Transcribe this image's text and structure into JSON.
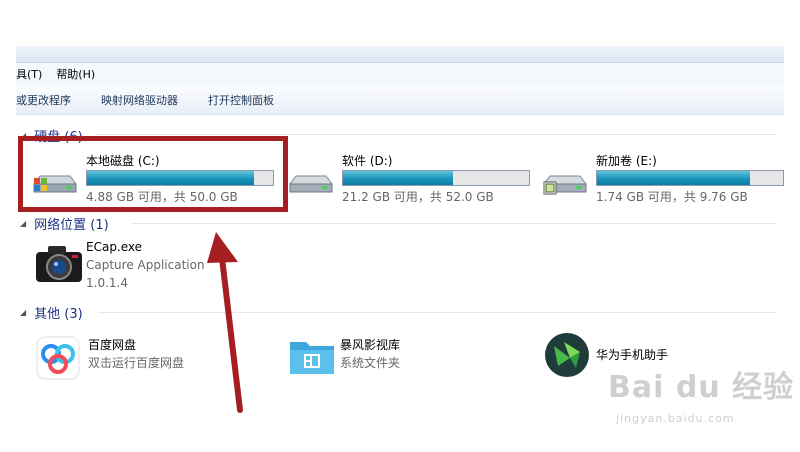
{
  "menu": [
    "具(T)",
    "帮助(H)"
  ],
  "toolbar": [
    "或更改程序",
    "映射网络驱动器",
    "打开控制面板"
  ],
  "groups": {
    "hdd": "硬盘 (6)",
    "network": "网络位置 (1)",
    "other": "其他 (3)"
  },
  "drives": [
    {
      "name": "本地磁盘 (C:)",
      "info": "4.88 GB 可用，共 50.0 GB",
      "used_fraction": 0.9
    },
    {
      "name": "软件 (D:)",
      "info": "21.2 GB 可用，共 52.0 GB",
      "used_fraction": 0.59
    },
    {
      "name": "新加卷 (E:)",
      "info": "1.74 GB 可用，共 9.76 GB",
      "used_fraction": 0.82
    }
  ],
  "network_item": {
    "name": "ECap.exe",
    "desc": "Capture Application",
    "version": "1.0.1.4"
  },
  "other_items": [
    {
      "name": "百度网盘",
      "desc": "双击运行百度网盘"
    },
    {
      "name": "暴风影视库",
      "desc": "系统文件夹"
    },
    {
      "name": "华为手机助手",
      "desc": ""
    }
  ],
  "watermark": {
    "logo": "Bai du 经验",
    "url": "jingyan.baidu.com"
  },
  "colors": {
    "annotation_red": "#a51e22",
    "bar_fill": "#1a93b8",
    "group_header": "#1e3287"
  }
}
